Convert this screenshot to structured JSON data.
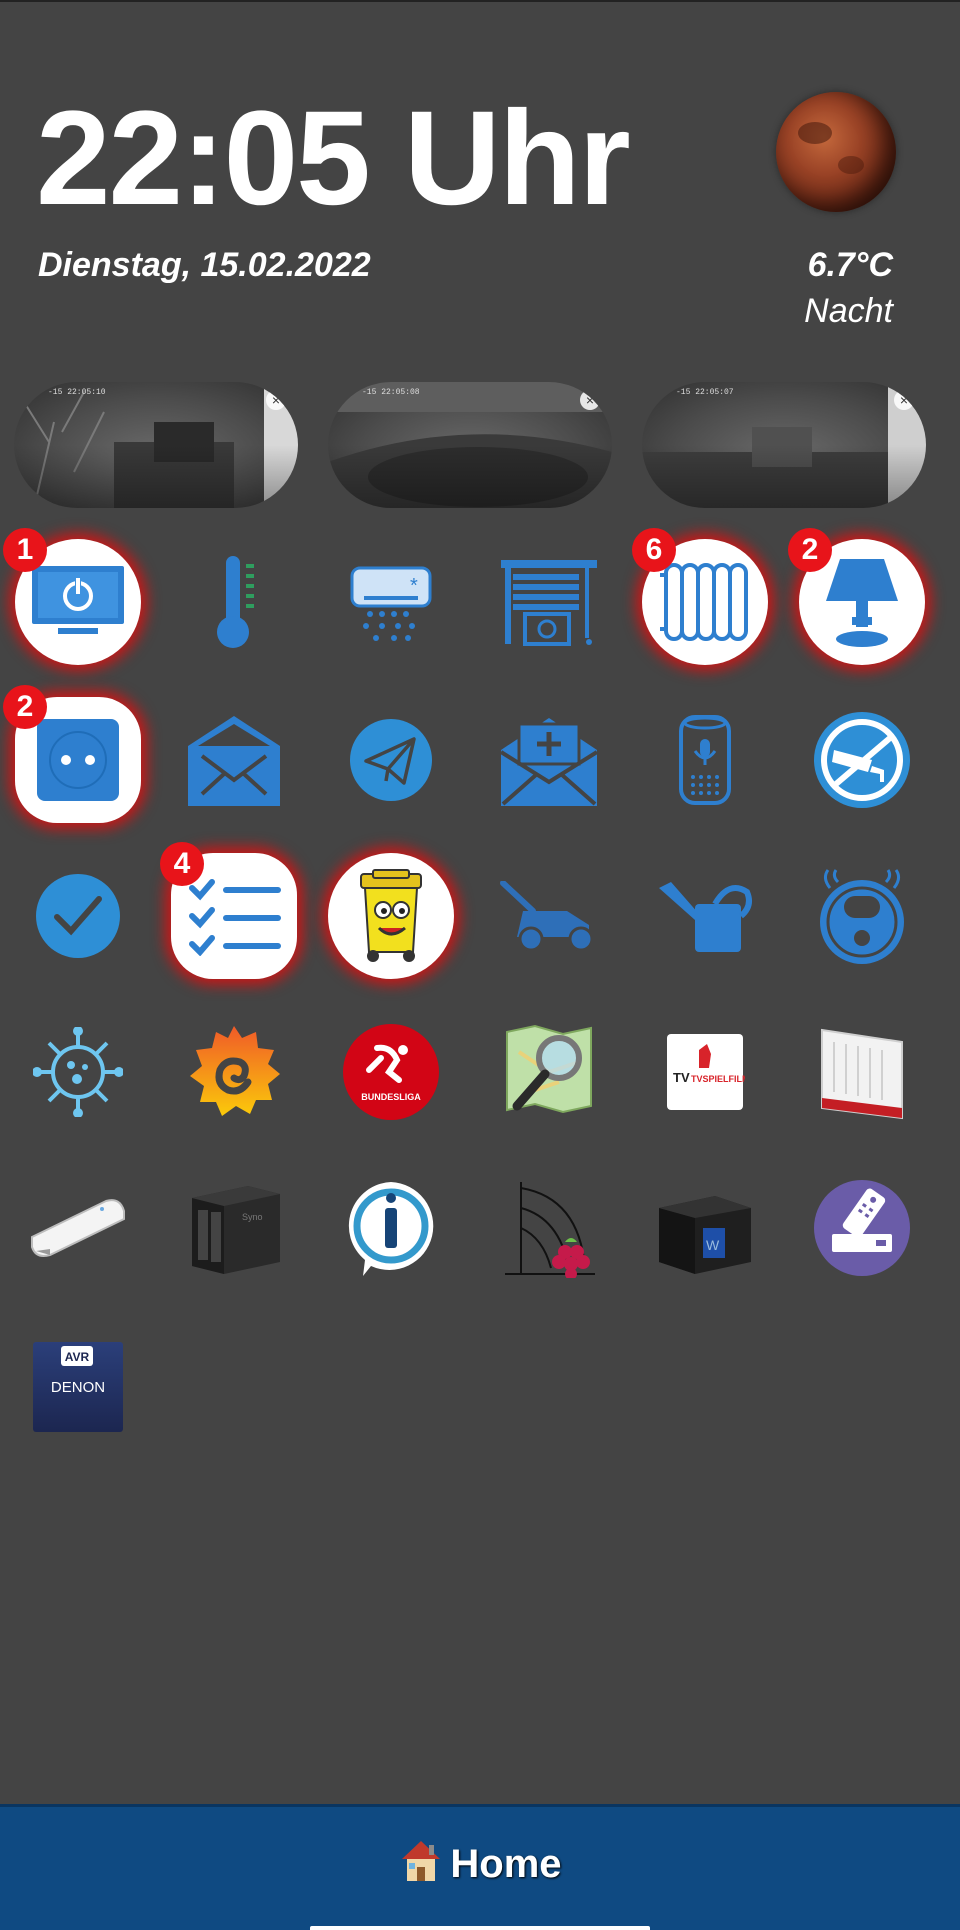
{
  "header": {
    "time": "22:05 Uhr",
    "date": "Dienstag, 15.02.2022",
    "temperature": "6.7°C",
    "day_phase": "Nacht"
  },
  "cameras": [
    {
      "timestamp": "-15 22:05:10"
    },
    {
      "timestamp": "-15 22:05:08"
    },
    {
      "timestamp": "-15 22:05:07"
    }
  ],
  "badges": {
    "tv": "1",
    "heating": "6",
    "lamp": "2",
    "socket": "2",
    "tasks": "4"
  },
  "tiles": [
    [
      "tv-power-icon",
      "thermometer-icon",
      "air-conditioner-icon",
      "blinds-settings-icon",
      "radiator-icon",
      "table-lamp-icon"
    ],
    [
      "power-socket-icon",
      "mailbox-icon",
      "telegram-icon",
      "new-mail-icon",
      "smart-speaker-icon",
      "security-camera-icon"
    ],
    [
      "checkmark-icon",
      "task-list-icon",
      "trash-bin-mascot-icon",
      "lawn-mower-icon",
      "watering-can-icon",
      "robot-vacuum-icon"
    ],
    [
      "virus-icon",
      "grafana-icon",
      "bundesliga-icon",
      "map-search-icon",
      "tv-spielfilm-icon",
      "router-icon"
    ],
    [
      "usb-stick-icon",
      "nas-icon",
      "iobroker-icon",
      "raspberry-pi-icon",
      "media-player-icon",
      "remote-control-icon"
    ],
    [
      "denon-avr-icon"
    ]
  ],
  "logos": {
    "bundesliga": "BUNDESLIGA",
    "tvspielfilm": "TVSPIELFILM",
    "tvspielfilm_prefix": "TV",
    "denon_badge": "AVR",
    "denon": "DENON"
  },
  "nav": {
    "home_label": "Home"
  },
  "colors": {
    "background": "#444444",
    "icon_blue": "#2e7fcf",
    "badge_red": "#e8141a",
    "nav_blue": "#0f4a82"
  }
}
